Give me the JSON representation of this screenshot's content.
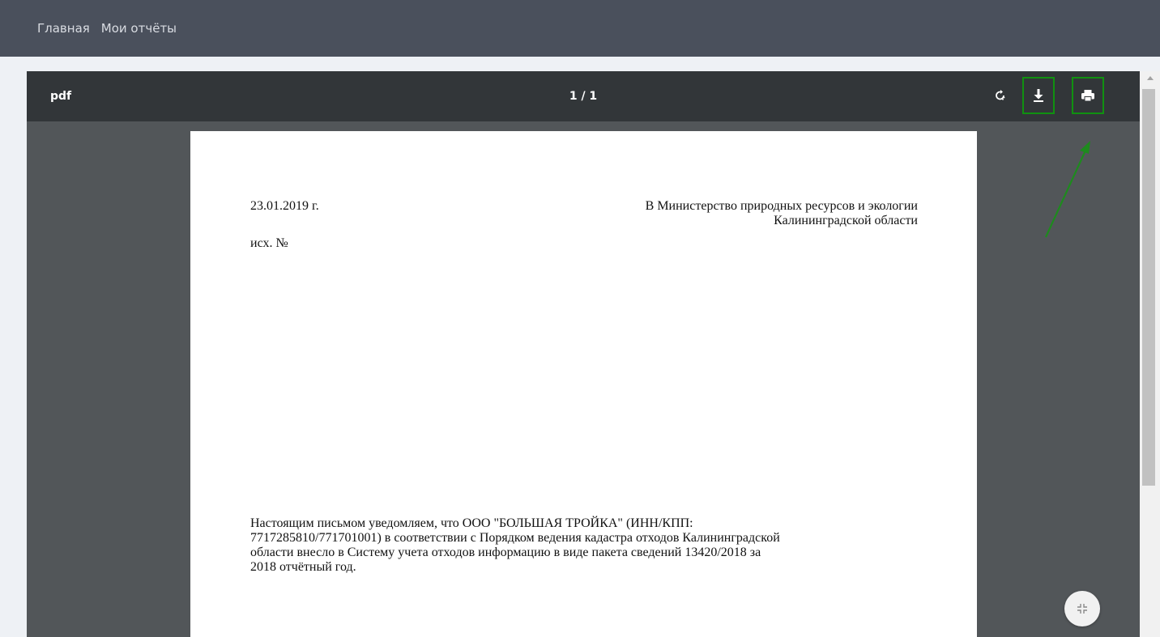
{
  "nav": {
    "items": [
      {
        "label": "Главная"
      },
      {
        "label": "Мои отчёты"
      }
    ]
  },
  "viewer": {
    "title": "pdf",
    "page_indicator": "1 / 1",
    "buttons": {
      "rotate": "rotate-icon",
      "download": "download-icon",
      "print": "print-icon",
      "fit": "fit-page-icon"
    }
  },
  "document": {
    "date": "23.01.2019 г.",
    "ref": "исх. №",
    "address_line1": "В Министерство природных ресурсов и экологии",
    "address_line2": "Калининградской области",
    "body_lines": [
      "Настоящим письмом уведомляем, что ООО \"БОЛЬШАЯ ТРОЙКА\" (ИНН/КПП:",
      "7717285810/771701001) в соответствии с Порядком ведения кадастра отходов Калининградской",
      "области внесло в Систему учета отходов информацию в виде пакета сведений 13420/2018 за",
      "2018 отчётный год."
    ]
  },
  "colors": {
    "highlight": "#109110",
    "toolbar": "#323639",
    "viewer_bg": "#525659",
    "nav_bg": "#4a505c"
  }
}
